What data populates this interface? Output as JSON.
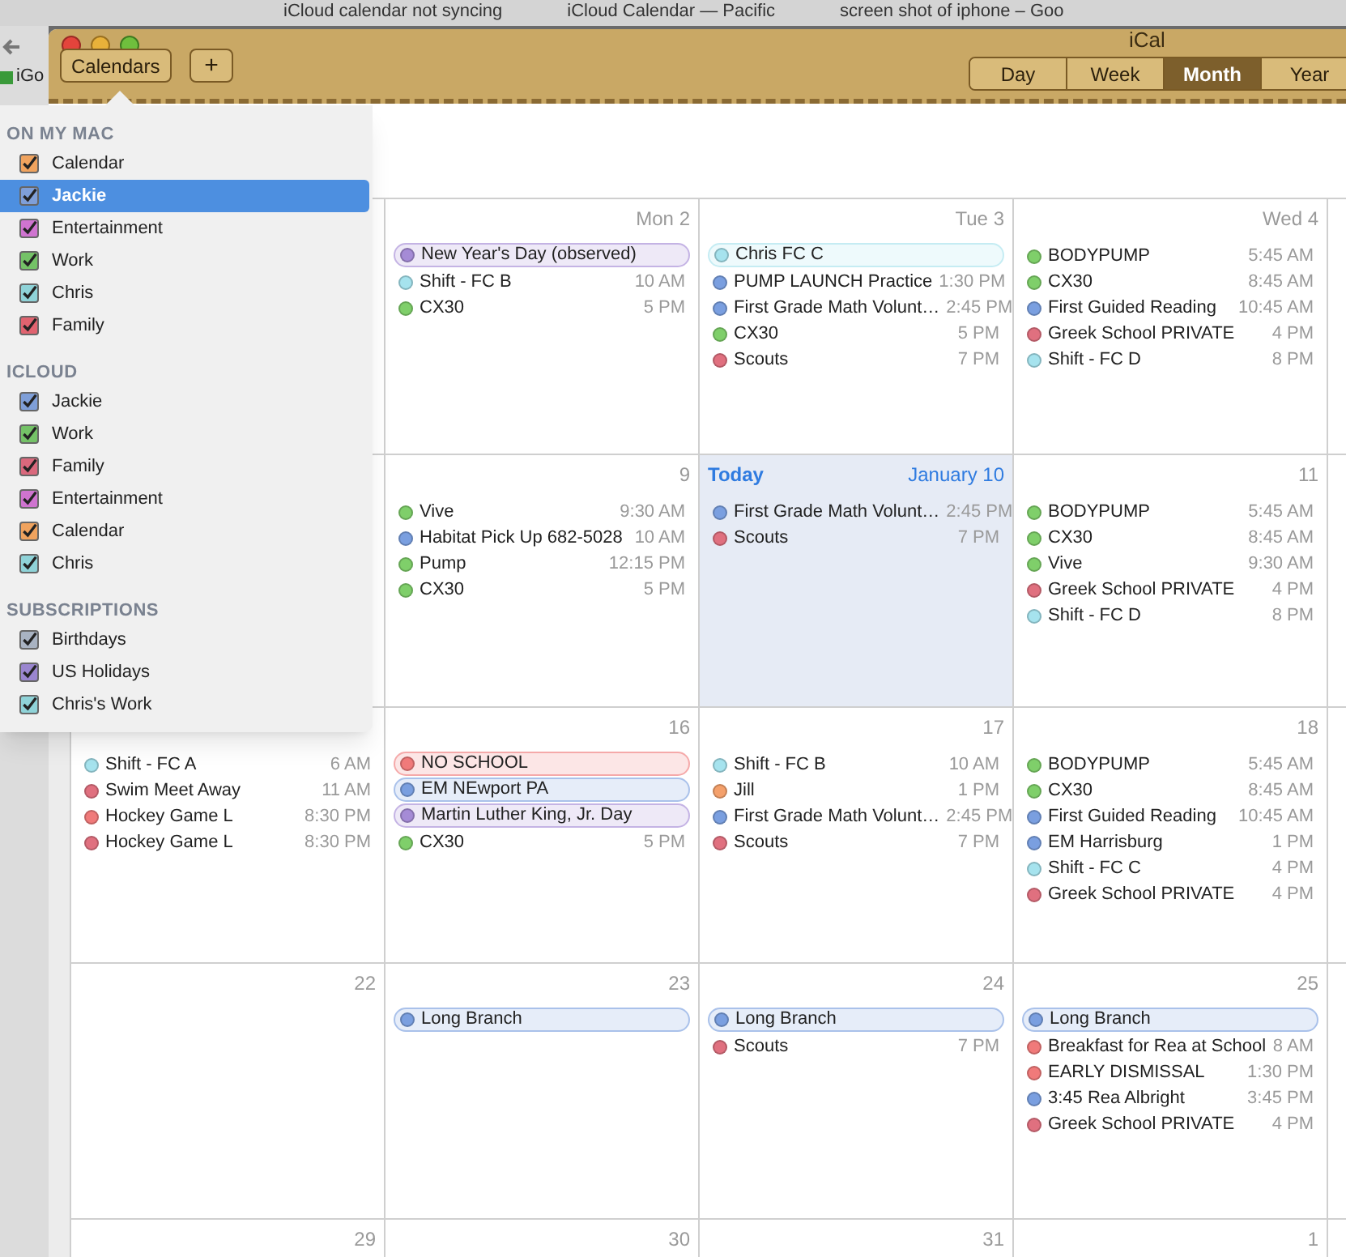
{
  "browser": {
    "tabs": [
      "iCloud calendar not syncing",
      "iCloud Calendar — Pacific",
      "screen shot of iphone – Goo"
    ],
    "bookmark": "iGo"
  },
  "window": {
    "title": "iCal"
  },
  "toolbar": {
    "calendars_button": "Calendars",
    "add_button": "+",
    "views": [
      {
        "label": "Day",
        "selected": false
      },
      {
        "label": "Week",
        "selected": false
      },
      {
        "label": "Month",
        "selected": true
      },
      {
        "label": "Year",
        "selected": false
      }
    ]
  },
  "calendar_list": [
    {
      "heading": "ON MY MAC",
      "items": [
        {
          "label": "Calendar",
          "color": "#f0a35e",
          "checked": true,
          "selected": false
        },
        {
          "label": "Jackie",
          "color": "#7f9fd8",
          "checked": true,
          "selected": true
        },
        {
          "label": "Entertainment",
          "color": "#cf74d0",
          "checked": true,
          "selected": false
        },
        {
          "label": "Work",
          "color": "#74c267",
          "checked": true,
          "selected": false
        },
        {
          "label": "Chris",
          "color": "#8fd3d8",
          "checked": true,
          "selected": false
        },
        {
          "label": "Family",
          "color": "#e0636f",
          "checked": true,
          "selected": false
        }
      ]
    },
    {
      "heading": "ICLOUD",
      "items": [
        {
          "label": "Jackie",
          "color": "#7f9fd8",
          "checked": true,
          "selected": false
        },
        {
          "label": "Work",
          "color": "#74c267",
          "checked": true,
          "selected": false
        },
        {
          "label": "Family",
          "color": "#d9687c",
          "checked": true,
          "selected": false
        },
        {
          "label": "Entertainment",
          "color": "#cf74d0",
          "checked": true,
          "selected": false
        },
        {
          "label": "Calendar",
          "color": "#f0a35e",
          "checked": true,
          "selected": false
        },
        {
          "label": "Chris",
          "color": "#8fd3d8",
          "checked": true,
          "selected": false
        }
      ]
    },
    {
      "heading": "SUBSCRIPTIONS",
      "items": [
        {
          "label": "Birthdays",
          "color": "#a9b3c2",
          "checked": true,
          "selected": false
        },
        {
          "label": "US Holidays",
          "color": "#9a86cf",
          "checked": true,
          "selected": false
        },
        {
          "label": "Chris's Work",
          "color": "#8fd3d8",
          "checked": true,
          "selected": false
        }
      ]
    }
  ],
  "weeks": [
    {
      "days": [
        {
          "label": "Mon 2",
          "events": [
            {
              "kind": "allday",
              "title": "New Year's Day (observed)",
              "color": "#a58bd6"
            },
            {
              "kind": "timed",
              "title": "Shift - FC B",
              "time": "10 AM",
              "color": "#a6e3ee"
            },
            {
              "kind": "timed",
              "title": "CX30",
              "time": "5 PM",
              "color": "#7fcf6a"
            }
          ]
        },
        {
          "label": "Tue 3",
          "events": [
            {
              "kind": "allday",
              "title": "Chris FC C",
              "color": "#a6e3ee"
            },
            {
              "kind": "timed",
              "title": "PUMP LAUNCH Practice",
              "time": "1:30 PM",
              "color": "#7a9fe0"
            },
            {
              "kind": "timed",
              "title": "First Grade Math Volunt…",
              "time": "2:45 PM",
              "color": "#7a9fe0"
            },
            {
              "kind": "timed",
              "title": "CX30",
              "time": "5 PM",
              "color": "#7fcf6a"
            },
            {
              "kind": "timed",
              "title": "Scouts",
              "time": "7 PM",
              "color": "#e0707f"
            }
          ]
        },
        {
          "label": "Wed 4",
          "events": [
            {
              "kind": "timed",
              "title": "BODYPUMP",
              "time": "5:45 AM",
              "color": "#7fcf6a"
            },
            {
              "kind": "timed",
              "title": "CX30",
              "time": "8:45 AM",
              "color": "#7fcf6a"
            },
            {
              "kind": "timed",
              "title": "First Guided Reading",
              "time": "10:45 AM",
              "color": "#7a9fe0"
            },
            {
              "kind": "timed",
              "title": "Greek School PRIVATE",
              "time": "4 PM",
              "color": "#e0707f"
            },
            {
              "kind": "timed",
              "title": "Shift - FC D",
              "time": "8 PM",
              "color": "#a6e3ee"
            }
          ]
        }
      ]
    },
    {
      "days": [
        {
          "label": "9",
          "events": [
            {
              "kind": "timed",
              "title": "Vive",
              "time": "9:30 AM",
              "color": "#7fcf6a"
            },
            {
              "kind": "timed",
              "title": "Habitat Pick Up 682-5028",
              "time": "10 AM",
              "color": "#7a9fe0"
            },
            {
              "kind": "timed",
              "title": "Pump",
              "time": "12:15 PM",
              "color": "#7fcf6a"
            },
            {
              "kind": "timed",
              "title": "CX30",
              "time": "5 PM",
              "color": "#7fcf6a"
            }
          ]
        },
        {
          "today": true,
          "today_label": "Today",
          "label": "January 10",
          "events": [
            {
              "kind": "timed",
              "title": "First Grade Math Volunt…",
              "time": "2:45 PM",
              "color": "#7a9fe0"
            },
            {
              "kind": "timed",
              "title": "Scouts",
              "time": "7 PM",
              "color": "#e0707f"
            }
          ]
        },
        {
          "label": "11",
          "events": [
            {
              "kind": "timed",
              "title": "BODYPUMP",
              "time": "5:45 AM",
              "color": "#7fcf6a"
            },
            {
              "kind": "timed",
              "title": "CX30",
              "time": "8:45 AM",
              "color": "#7fcf6a"
            },
            {
              "kind": "timed",
              "title": "Vive",
              "time": "9:30 AM",
              "color": "#7fcf6a"
            },
            {
              "kind": "timed",
              "title": "Greek School PRIVATE",
              "time": "4 PM",
              "color": "#e0707f"
            },
            {
              "kind": "timed",
              "title": "Shift - FC D",
              "time": "8 PM",
              "color": "#a6e3ee"
            }
          ]
        }
      ]
    },
    {
      "days": [
        {
          "events": [
            {
              "kind": "timed",
              "title": "Shift - FC A",
              "time": "6 AM",
              "color": "#a6e3ee"
            },
            {
              "kind": "timed",
              "title": "Swim Meet Away",
              "time": "11 AM",
              "color": "#e0707f"
            },
            {
              "kind": "timed",
              "title": "Hockey Game L",
              "time": "8:30 PM",
              "color": "#f07a7a"
            },
            {
              "kind": "timed",
              "title": "Hockey Game L",
              "time": "8:30 PM",
              "color": "#e0707f"
            }
          ]
        },
        {
          "label": "16",
          "events": [
            {
              "kind": "allday",
              "title": "NO SCHOOL",
              "color": "#f07a7a"
            },
            {
              "kind": "allday",
              "title": "EM NEwport PA",
              "color": "#7a9fe0"
            },
            {
              "kind": "allday",
              "title": "Martin Luther King, Jr. Day",
              "color": "#a58bd6"
            },
            {
              "kind": "timed",
              "title": "CX30",
              "time": "5 PM",
              "color": "#7fcf6a"
            }
          ]
        },
        {
          "label": "17",
          "events": [
            {
              "kind": "timed",
              "title": "Shift - FC B",
              "time": "10 AM",
              "color": "#a6e3ee"
            },
            {
              "kind": "timed",
              "title": "Jill",
              "time": "1 PM",
              "color": "#f4a06b"
            },
            {
              "kind": "timed",
              "title": "First Grade Math Volunt…",
              "time": "2:45 PM",
              "color": "#7a9fe0"
            },
            {
              "kind": "timed",
              "title": "Scouts",
              "time": "7 PM",
              "color": "#e0707f"
            }
          ]
        },
        {
          "label": "18",
          "events": [
            {
              "kind": "timed",
              "title": "BODYPUMP",
              "time": "5:45 AM",
              "color": "#7fcf6a"
            },
            {
              "kind": "timed",
              "title": "CX30",
              "time": "8:45 AM",
              "color": "#7fcf6a"
            },
            {
              "kind": "timed",
              "title": "First Guided Reading",
              "time": "10:45 AM",
              "color": "#7a9fe0"
            },
            {
              "kind": "timed",
              "title": "EM Harrisburg",
              "time": "1 PM",
              "color": "#7a9fe0"
            },
            {
              "kind": "timed",
              "title": "Shift - FC C",
              "time": "4 PM",
              "color": "#a6e3ee"
            },
            {
              "kind": "timed",
              "title": "Greek School PRIVATE",
              "time": "4 PM",
              "color": "#e0707f"
            }
          ]
        }
      ]
    },
    {
      "days": [
        {
          "label": "22"
        },
        {
          "label": "23",
          "events": [
            {
              "kind": "allday",
              "title": "Long Branch",
              "color": "#7a9fe0"
            }
          ]
        },
        {
          "label": "24",
          "events": [
            {
              "kind": "allday",
              "title": "Long Branch",
              "color": "#7a9fe0"
            },
            {
              "kind": "timed",
              "title": "Scouts",
              "time": "7 PM",
              "color": "#e0707f"
            }
          ]
        },
        {
          "label": "25",
          "events": [
            {
              "kind": "allday",
              "title": "Long Branch",
              "color": "#7a9fe0"
            },
            {
              "kind": "timed",
              "title": "Breakfast for Rea at School",
              "time": "8 AM",
              "color": "#f07a7a"
            },
            {
              "kind": "timed",
              "title": "EARLY DISMISSAL",
              "time": "1:30 PM",
              "color": "#f07a7a"
            },
            {
              "kind": "timed",
              "title": "3:45 Rea Albright",
              "time": "3:45 PM",
              "color": "#7a9fe0"
            },
            {
              "kind": "timed",
              "title": "Greek School PRIVATE",
              "time": "4 PM",
              "color": "#e0707f"
            }
          ]
        }
      ]
    },
    {
      "days": [
        {
          "label": "29"
        },
        {
          "label": "30"
        },
        {
          "label": "31"
        },
        {
          "label": "1"
        }
      ]
    }
  ]
}
